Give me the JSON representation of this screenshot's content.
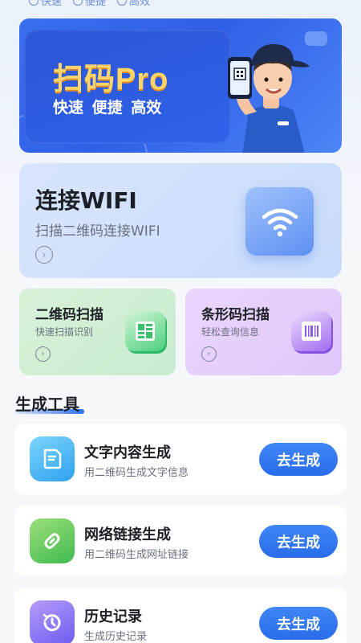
{
  "top_tags": [
    "快速",
    "便捷",
    "高效"
  ],
  "banner": {
    "title": "扫码Pro",
    "subtitle": "快速  便捷  高效"
  },
  "wifi_card": {
    "title": "连接WIFI",
    "desc": "扫描二维码连接WIFI",
    "icon": "wifi-icon"
  },
  "qr_card": {
    "title": "二维码扫描",
    "desc": "快速扫描识别",
    "icon": "qr-icon"
  },
  "barcode_card": {
    "title": "条形码扫描",
    "desc": "轻松查询信息",
    "icon": "barcode-icon"
  },
  "section": {
    "title": "生成工具"
  },
  "tools": [
    {
      "name": "文字内容生成",
      "desc": "用二维码生成文字信息",
      "button": "去生成",
      "icon": "document-icon"
    },
    {
      "name": "网络链接生成",
      "desc": "用二维码生成网址链接",
      "button": "去生成",
      "icon": "link-icon"
    },
    {
      "name": "历史记录",
      "desc": "生成历史记录",
      "button": "去生成",
      "icon": "history-icon"
    }
  ],
  "colors": {
    "accent": "#2c71f0",
    "banner_title": "#ffd56a",
    "wifi_bg": "#d3e2fb",
    "qr_bg": "#d2efd5",
    "barcode_bg": "#e6d2fb"
  }
}
